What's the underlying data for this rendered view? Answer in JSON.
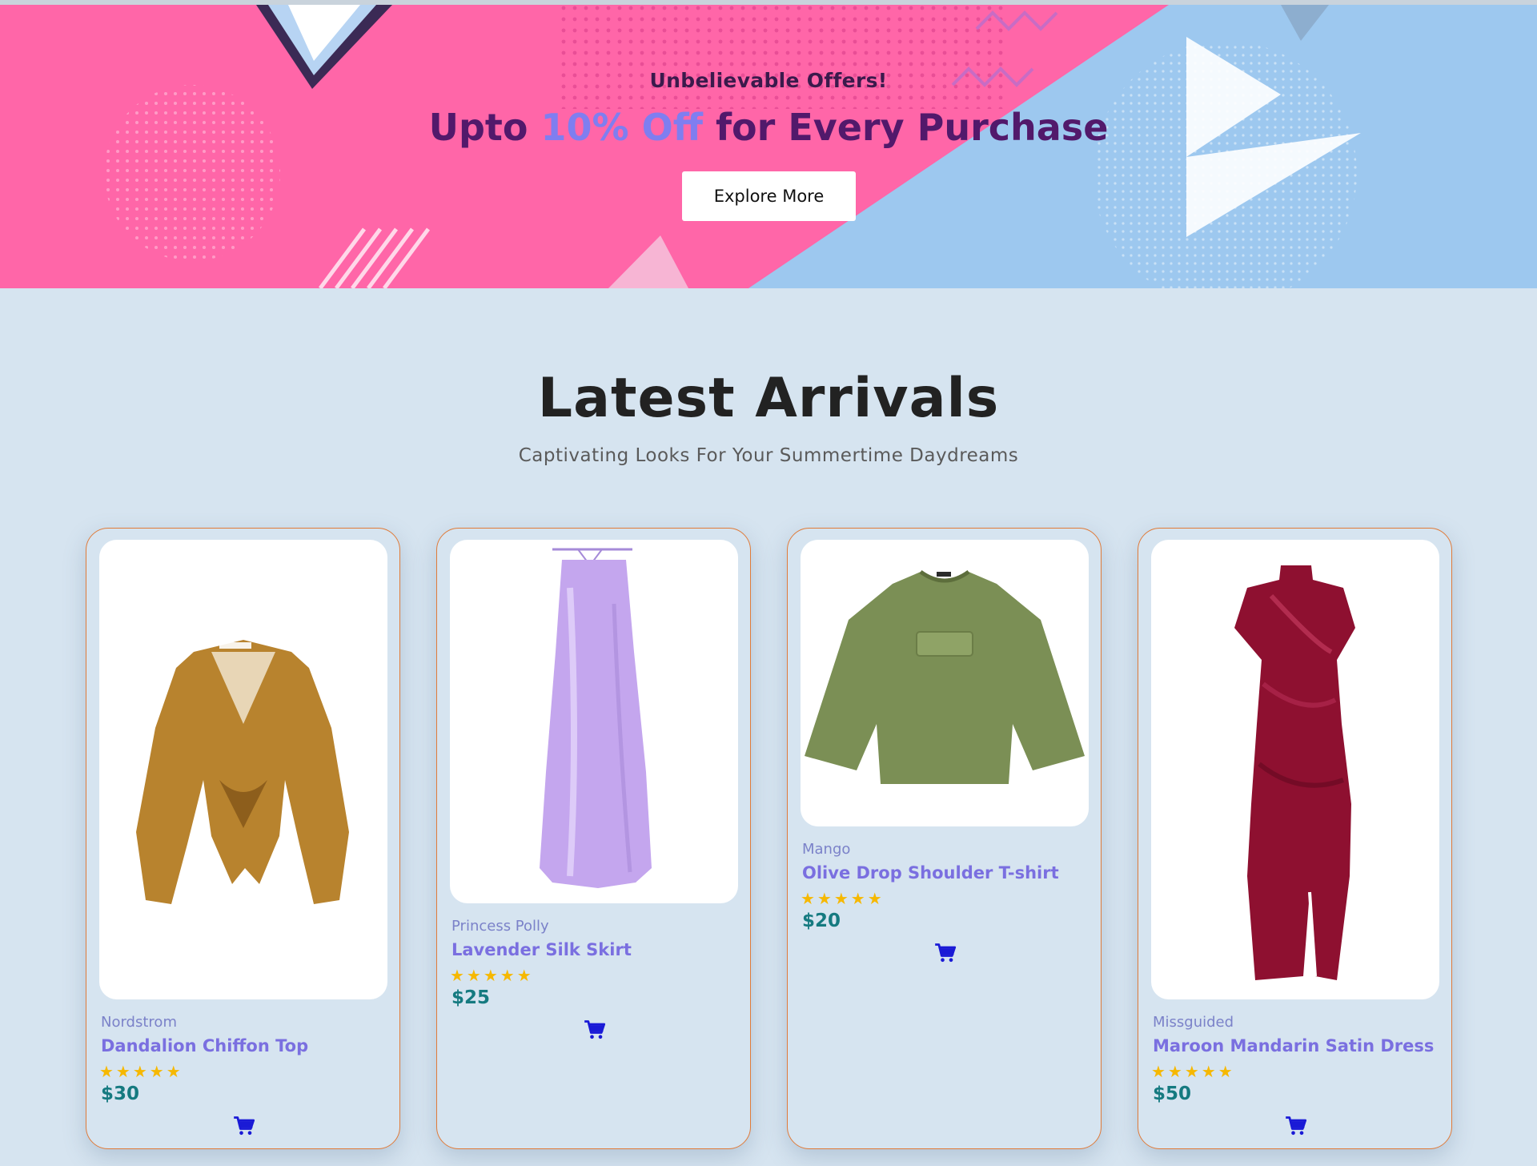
{
  "banner": {
    "kicker": "Unbelievable Offers!",
    "title_prefix": "Upto ",
    "title_accent": "10% Off",
    "title_suffix": " for Every Purchase",
    "button_label": "Explore More"
  },
  "section": {
    "title": "Latest Arrivals",
    "subtitle": "Captivating Looks For Your Summertime Daydreams"
  },
  "products": [
    {
      "brand": "Nordstrom",
      "name": "Dandalion Chiffon Top",
      "rating": 5,
      "stars": "★★★★★",
      "price": "$30",
      "image_icon": "blouse-icon",
      "color": "#b8832e"
    },
    {
      "brand": "Princess Polly",
      "name": "Lavender Silk Skirt",
      "rating": 5,
      "stars": "★★★★★",
      "price": "$25",
      "image_icon": "skirt-icon",
      "color": "#c4a6ee"
    },
    {
      "brand": "Mango",
      "name": "Olive Drop Shoulder T-shirt",
      "rating": 5,
      "stars": "★★★★★",
      "price": "$20",
      "image_icon": "tshirt-icon",
      "color": "#7b8f55"
    },
    {
      "brand": "Missguided",
      "name": "Maroon Mandarin Satin Dress",
      "rating": 5,
      "stars": "★★★★★",
      "price": "$50",
      "image_icon": "dress-icon",
      "color": "#8e1030"
    }
  ],
  "colors": {
    "page_bg": "#d6e4f0",
    "banner_pink": "#ff66a8",
    "banner_blue": "#9dc8ef",
    "accent_text": "#7f7ef0",
    "card_border": "#e07b39",
    "price": "#157a80",
    "star": "#f6b800",
    "cart_icon": "#1a1ad6"
  },
  "icons": {
    "cart": "shopping-cart-icon",
    "rating": "star-icon"
  }
}
